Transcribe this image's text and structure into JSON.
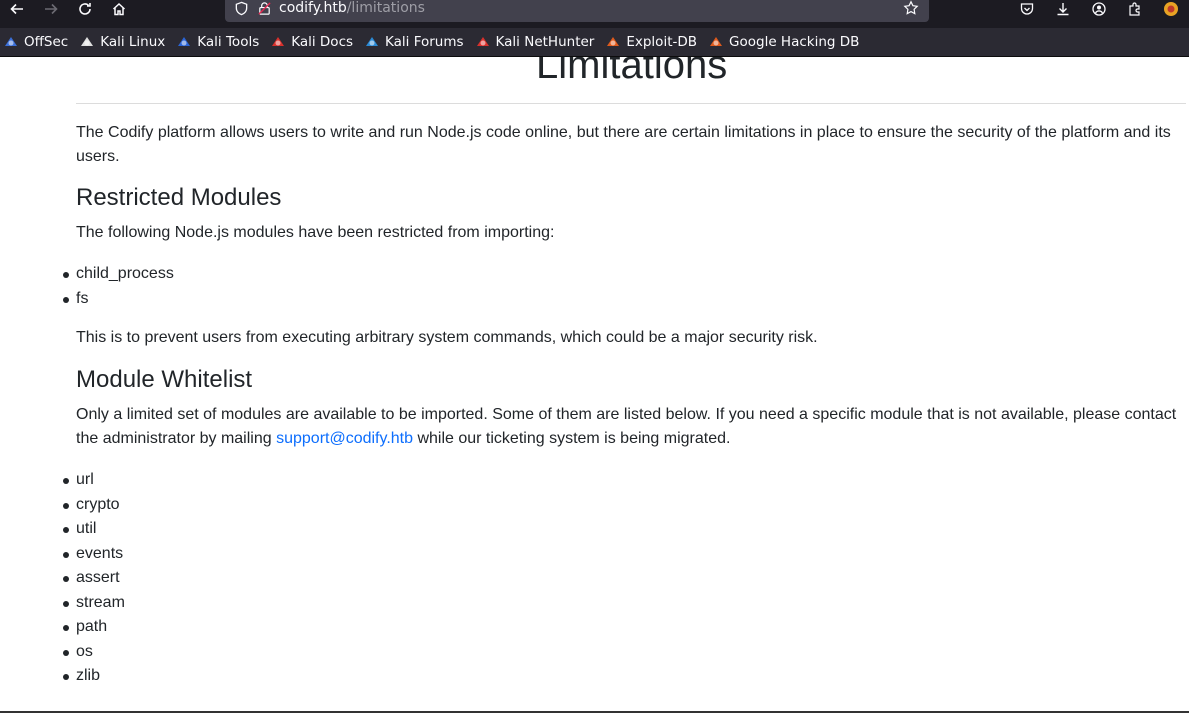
{
  "browser": {
    "url_host": "codify.htb",
    "url_path": "/limitations",
    "bookmarks": [
      {
        "label": "OffSec",
        "icon": "offsec-icon",
        "color": "#3b6fd8"
      },
      {
        "label": "Kali Linux",
        "icon": "kali-dragon-icon",
        "color": "#e0e0e0"
      },
      {
        "label": "Kali Tools",
        "icon": "kali-tools-icon",
        "color": "#2a64d6"
      },
      {
        "label": "Kali Docs",
        "icon": "kali-docs-icon",
        "color": "#d9302c"
      },
      {
        "label": "Kali Forums",
        "icon": "kali-forums-icon",
        "color": "#2a8ad6"
      },
      {
        "label": "Kali NetHunter",
        "icon": "nethunter-icon",
        "color": "#d9302c"
      },
      {
        "label": "Exploit-DB",
        "icon": "exploitdb-icon",
        "color": "#e05a1c"
      },
      {
        "label": "Google Hacking DB",
        "icon": "ghdb-icon",
        "color": "#e05a1c"
      }
    ]
  },
  "page": {
    "title": "Limitations",
    "intro": "The Codify platform allows users to write and run Node.js code online, but there are certain limitations in place to ensure the security of the platform and its users.",
    "restricted": {
      "heading": "Restricted Modules",
      "text": "The following Node.js modules have been restricted from importing:",
      "modules": [
        "child_process",
        "fs"
      ],
      "note": "This is to prevent users from executing arbitrary system commands, which could be a major security risk."
    },
    "whitelist": {
      "heading": "Module Whitelist",
      "text_before": "Only a limited set of modules are available to be imported. Some of them are listed below. If you need a specific module that is not available, please contact the administrator by mailing ",
      "email": "support@codify.htb",
      "text_after": " while our ticketing system is being migrated.",
      "modules": [
        "url",
        "crypto",
        "util",
        "events",
        "assert",
        "stream",
        "path",
        "os",
        "zlib"
      ]
    }
  },
  "colors": {
    "link": "#0d6efd",
    "text": "#212529",
    "chrome_bg": "#1c1b22",
    "urlbar_bg": "#42414d",
    "bookmarks_bg": "#2b2a33"
  }
}
